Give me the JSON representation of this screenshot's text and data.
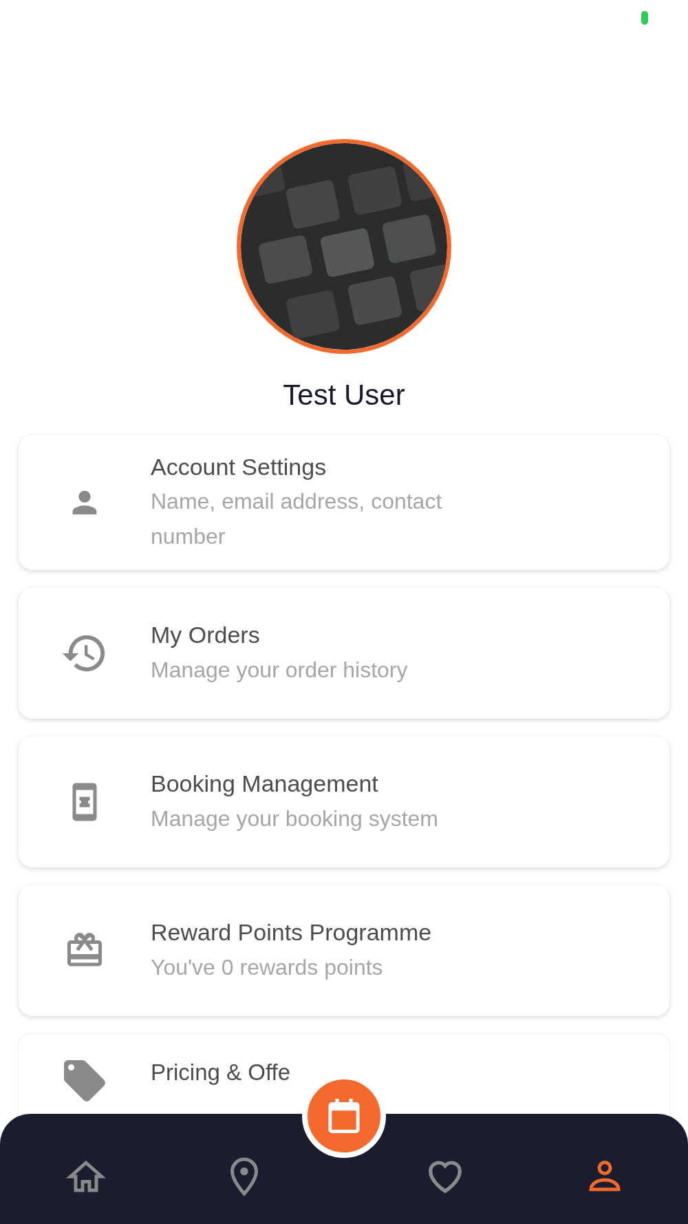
{
  "profile": {
    "name": "Test User"
  },
  "menu": [
    {
      "title": "Account Settings",
      "subtitle": "Name, email address, contact number"
    },
    {
      "title": "My Orders",
      "subtitle": "Manage your order history"
    },
    {
      "title": "Booking Management",
      "subtitle": "Manage your booking system"
    },
    {
      "title": "Reward Points Programme",
      "subtitle": "You've 0 rewards points"
    },
    {
      "title": "Pricing & Offe"
    }
  ],
  "bottom_nav": [
    {
      "selected": false
    },
    {
      "selected": false
    },
    {
      "selected": false
    },
    {
      "selected": true
    }
  ]
}
